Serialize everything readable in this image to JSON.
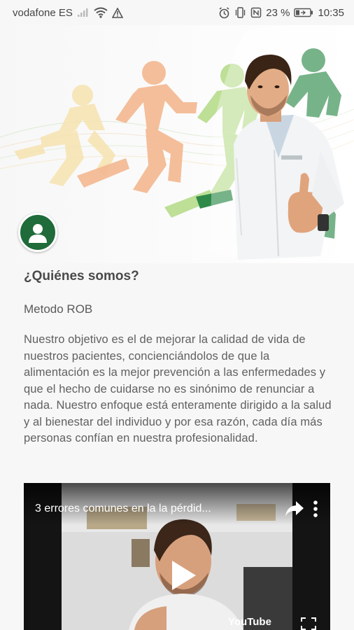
{
  "status_bar": {
    "carrier": "vodafone ES",
    "battery_percent": "23 %",
    "time": "10:35",
    "icons": [
      "signal-icon",
      "wifi-icon",
      "warning-icon",
      "alarm-icon",
      "vibrate-icon",
      "nfc-icon",
      "battery-icon"
    ]
  },
  "header": {
    "avatar_icon": "user-icon",
    "brand_green": "#1f6b3a"
  },
  "content": {
    "title": "¿Quiénes somos?",
    "subtitle": "Metodo ROB",
    "body": "Nuestro objetivo es el de mejorar la calidad de vida de nuestros pacientes, concienciándolos de que la alimentación es la mejor prevención a las enfermedades y que el hecho de cuidarse no es sinónimo de renunciar a nada. Nuestro enfoque está enteramente dirigido a la salud y al bienestar del individuo y por esa razón, cada día más personas confían en nuestra profesionalidad."
  },
  "video": {
    "title": "3 errores comunes en la la pérdid...",
    "brand": "YouTube",
    "icons": [
      "share-icon",
      "more-vert-icon",
      "play-icon",
      "fullscreen-icon"
    ]
  }
}
